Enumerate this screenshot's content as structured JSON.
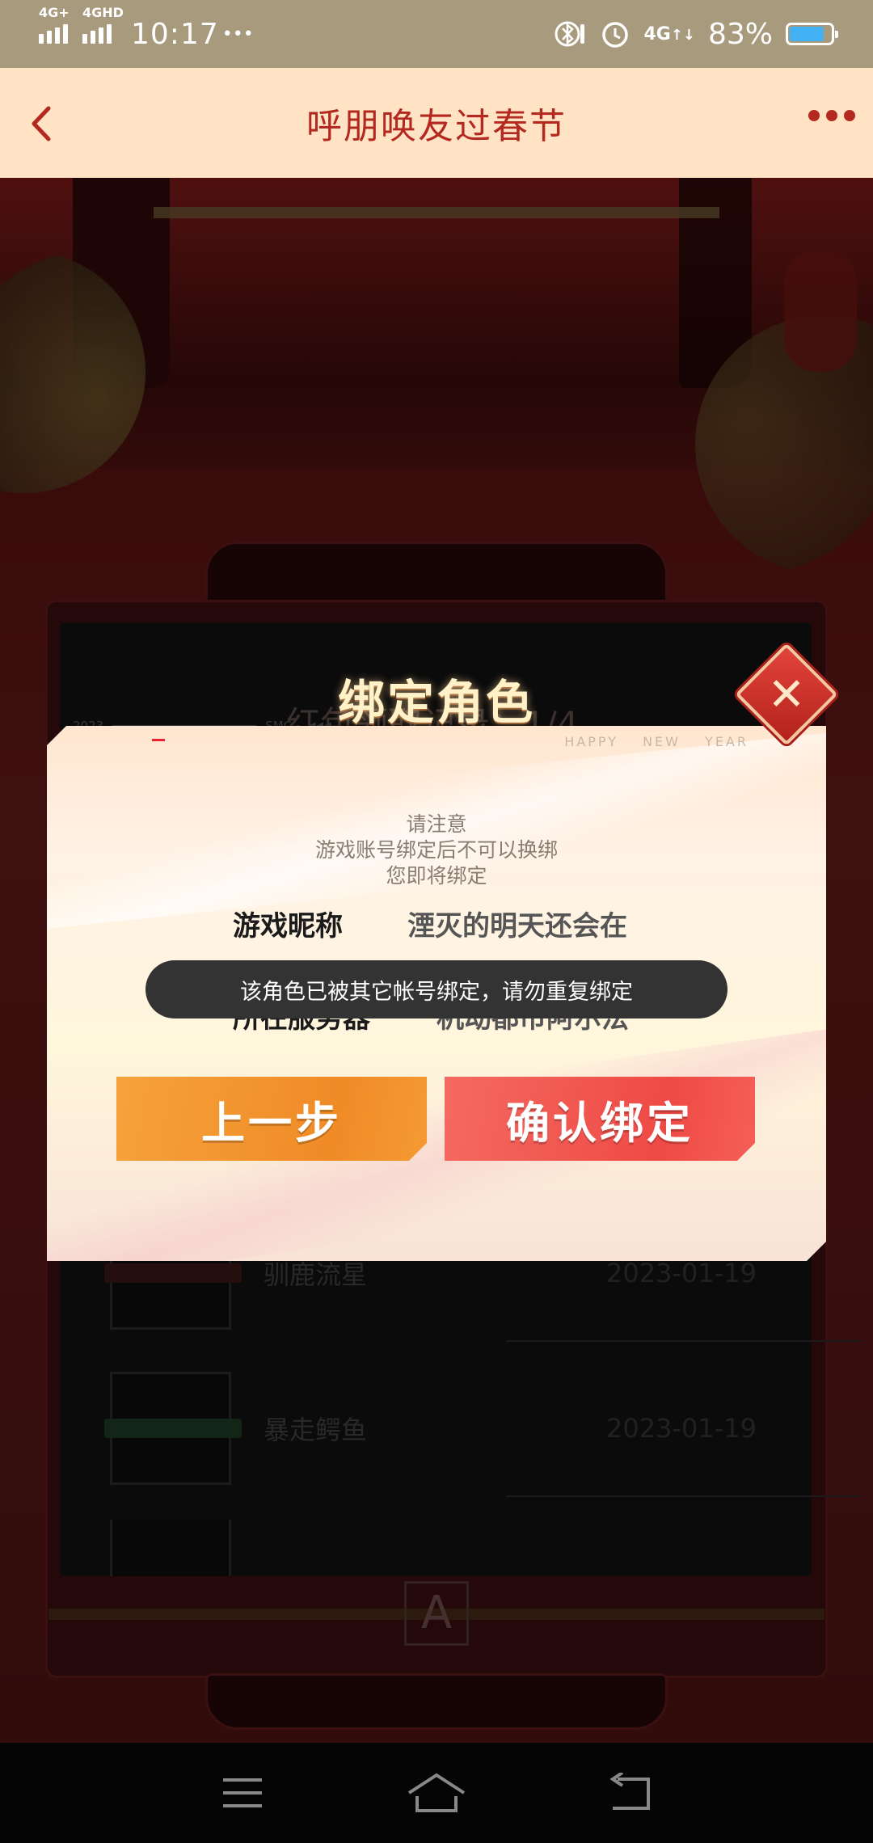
{
  "status_bar": {
    "signal1_label": "4G+",
    "signal2_label": "4GHD",
    "time": "10:17",
    "more_dots": "•••",
    "data_label": "4G",
    "battery": "83%",
    "battery_level": 0.83,
    "battery_color": "#43b2f5"
  },
  "app_bar": {
    "title": "呼朋唤友过春节",
    "accent_color": "#b3281f",
    "background": "#ffe3c4"
  },
  "background_panel": {
    "year_label": "2023",
    "smc_label": "SMC",
    "arrows_label": "◀◀◀",
    "record_title": "红包领取记录：1/4",
    "records": [
      {
        "name": "驯鹿流星",
        "date": "2023-01-19"
      },
      {
        "name": "暴走鳄鱼",
        "date": "2023-01-19"
      }
    ],
    "logo": "A"
  },
  "modal": {
    "title": "绑定角色",
    "decor_text": "HAPPY NEW YEAR",
    "notice_lines": [
      "请注意",
      "游戏账号绑定后不可以换绑",
      "您即将绑定"
    ],
    "fields": [
      {
        "label": "游戏昵称",
        "value": "湮灭的明天还会在"
      },
      {
        "label": "所在服务器",
        "value": "机动都市阿尔法"
      }
    ],
    "prev_button": "上一步",
    "confirm_button": "确认绑定",
    "close_icon": "close-icon"
  },
  "toast": {
    "message": "该角色已被其它帐号绑定，请勿重复绑定"
  },
  "nav_bar": {
    "menu_icon": "menu-icon",
    "home_icon": "home-icon",
    "back_icon": "back-icon"
  }
}
